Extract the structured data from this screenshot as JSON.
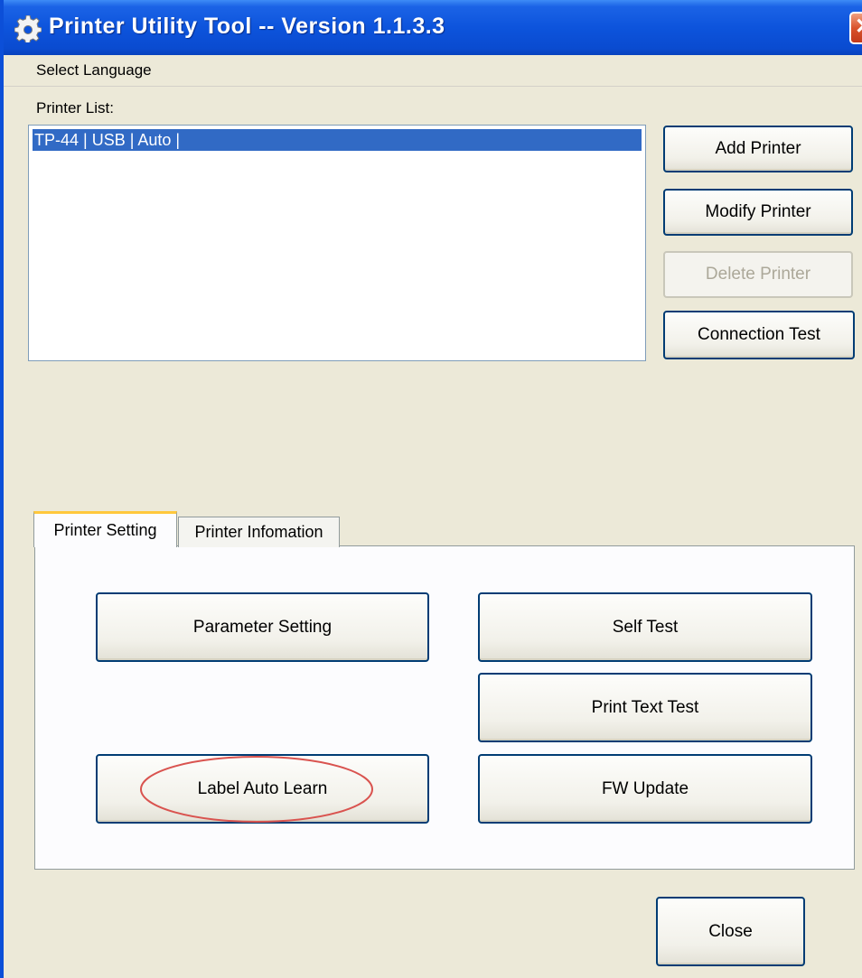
{
  "window": {
    "title": "Printer Utility Tool -- Version 1.1.3.3",
    "close_glyph": "✕",
    "title_icon": "gear-icon",
    "colors": {
      "titlebar": "#0c54dc",
      "client": "#ece9d8",
      "selection": "#316ac5",
      "annotation": "#d9534f"
    }
  },
  "menu": {
    "items": [
      "Select Language"
    ]
  },
  "printer_list": {
    "label": "Printer List:",
    "items": [
      {
        "text": "TP-44 | USB | Auto |",
        "selected": true
      }
    ]
  },
  "side_buttons": {
    "add": "Add Printer",
    "modify": "Modify Printer",
    "delete": "Delete Printer",
    "connection": "Connection Test"
  },
  "tabs": [
    {
      "label": "Printer Setting",
      "active": true
    },
    {
      "label": "Printer Infomation",
      "active": false
    }
  ],
  "settings": {
    "parameter": "Parameter Setting",
    "self_test": "Self Test",
    "print_text_test": "Print Text Test",
    "label_auto_learn": "Label Auto Learn",
    "fw_update": "FW Update"
  },
  "close_label": "Close"
}
